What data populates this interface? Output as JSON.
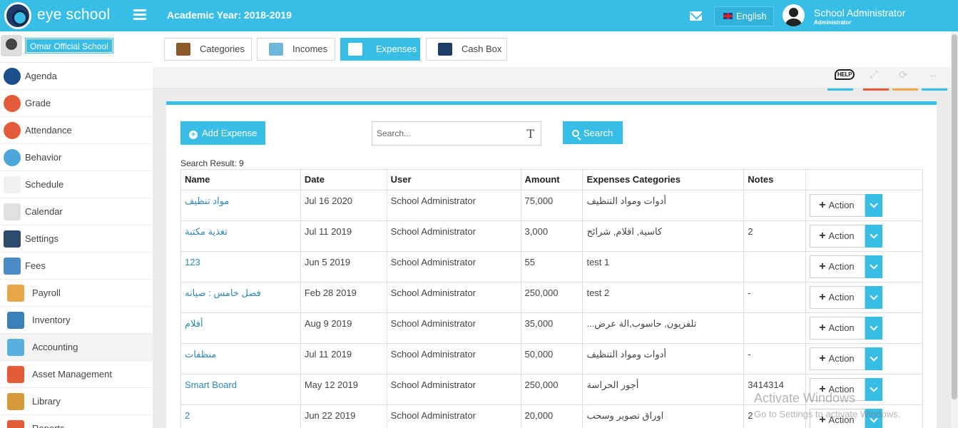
{
  "header": {
    "brand": "eye school",
    "academic_year": "Academic Year: 2018-2019",
    "language": "English",
    "user_name": "School Administrator",
    "user_role": "Administrator"
  },
  "sidebar": {
    "school_name": "Omar Official School",
    "items": [
      {
        "label": "Agenda",
        "icon": "agenda-icon",
        "color": "#1d4f8c"
      },
      {
        "label": "Grade",
        "icon": "grade-icon",
        "color": "#e45b3a"
      },
      {
        "label": "Attendance",
        "icon": "attendance-icon",
        "color": "#e45b3a"
      },
      {
        "label": "Behavior",
        "icon": "behavior-icon",
        "color": "#4da6d8"
      },
      {
        "label": "Schedule",
        "icon": "schedule-icon",
        "color": "#f0f0f0"
      },
      {
        "label": "Calendar",
        "icon": "calendar-icon",
        "color": "#e0e0e0"
      },
      {
        "label": "Settings",
        "icon": "settings-icon",
        "color": "#2d4b6e"
      },
      {
        "label": "Fees",
        "icon": "fees-icon",
        "color": "#4a8bc4"
      },
      {
        "label": "Payroll",
        "icon": "payroll-icon",
        "color": "#e8a64a"
      },
      {
        "label": "Inventory",
        "icon": "inventory-icon",
        "color": "#3b7fb9"
      },
      {
        "label": "Accounting",
        "icon": "accounting-icon",
        "color": "#5ab0dc"
      },
      {
        "label": "Asset Management",
        "icon": "asset-management-icon",
        "color": "#e45b3a"
      },
      {
        "label": "Library",
        "icon": "library-icon",
        "color": "#d49a3a"
      },
      {
        "label": "Reports",
        "icon": "reports-icon",
        "color": "#e45b3a"
      }
    ]
  },
  "tabs": [
    {
      "label": "Categories",
      "icon": "categories-icon"
    },
    {
      "label": "Incomes",
      "icon": "incomes-icon"
    },
    {
      "label": "Expenses",
      "icon": "expenses-icon"
    },
    {
      "label": "Cash Box",
      "icon": "cash-box-icon"
    }
  ],
  "toolbar": {
    "help_label": "HELP",
    "colors": {
      "help": "#38bde6",
      "fullscreen": "#e45b3a",
      "refresh": "#f0a94a",
      "expand": "#38bde6"
    }
  },
  "panel": {
    "add_label": "Add Expense",
    "search_placeholder": "Search...",
    "search_label": "Search",
    "result_text": "Search Result: 9"
  },
  "table": {
    "columns": [
      "Name",
      "Date",
      "User",
      "Amount",
      "Expenses Categories",
      "Notes",
      ""
    ],
    "action_label": "Action",
    "rows": [
      {
        "name": "مواد تنظيف",
        "date": "Jul 16 2020",
        "user": "School Administrator",
        "amount": "75,000",
        "category": "أدوات ومواد التنظيف",
        "notes": ""
      },
      {
        "name": "تغذية مكتبة",
        "date": "Jul 11 2019",
        "user": "School Administrator",
        "amount": "3,000",
        "category": "كاسية, اقلام, شرائح",
        "notes": "2"
      },
      {
        "name": "123",
        "date": "Jun 5 2019",
        "user": "School Administrator",
        "amount": "55",
        "category": "test 1",
        "notes": ""
      },
      {
        "name": "فصل خامس : صيانه",
        "date": "Feb 28 2019",
        "user": "School Administrator",
        "amount": "250,000",
        "category": "test 2",
        "notes": "-"
      },
      {
        "name": "أقلام",
        "date": "Aug 9 2019",
        "user": "School Administrator",
        "amount": "35,000",
        "category": "تلفزيون, حاسوب,الة عرض...",
        "notes": ""
      },
      {
        "name": "منظفات",
        "date": "Jul 11 2019",
        "user": "School Administrator",
        "amount": "50,000",
        "category": "أدوات ومواد التنظيف",
        "notes": "-"
      },
      {
        "name": "Smart Board",
        "date": "May 12 2019",
        "user": "School Administrator",
        "amount": "250,000",
        "category": "أجور الحراسة",
        "notes": "3414314"
      },
      {
        "name": "2",
        "date": "Jun 22 2019",
        "user": "School Administrator",
        "amount": "20,000",
        "category": "اوراق تصوير وسحب",
        "notes": "2"
      }
    ]
  },
  "watermark": {
    "line1": "Activate Windows",
    "line2": "Go to Settings to activate Windows."
  }
}
